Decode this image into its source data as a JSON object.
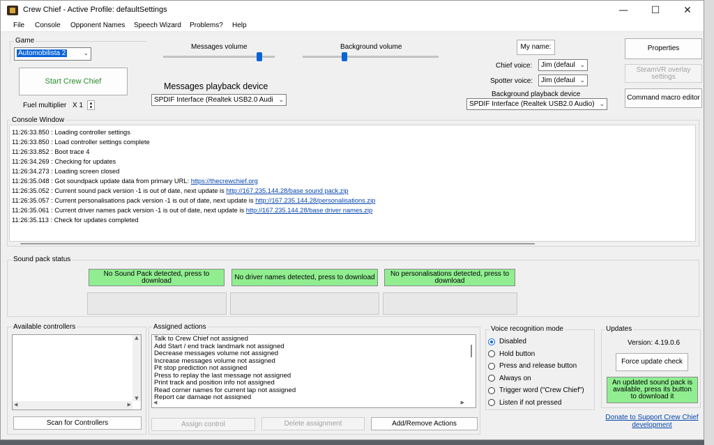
{
  "window": {
    "title": "Crew Chief - Active Profile: defaultSettings",
    "controls": {
      "minimize": "—",
      "maximize": "☐",
      "close": "✕"
    }
  },
  "menu": [
    "File",
    "Console",
    "Opponent Names",
    "Speech Wizard",
    "Problems?",
    "Help"
  ],
  "game": {
    "group_label": "Game",
    "selected": "Automobilista 2",
    "start_button": "Start Crew Chief",
    "fuel_multiplier_label": "Fuel multiplier",
    "fuel_multiplier_value": "X 1"
  },
  "volume": {
    "messages_label": "Messages volume",
    "messages_level": 0.88,
    "background_label": "Background volume",
    "background_level": 0.3
  },
  "playback": {
    "messages_device_label": "Messages playback device",
    "messages_device_value": "SPDIF Interface (Realtek USB2.0 Audi",
    "background_device_label": "Background playback device",
    "background_device_value": "SPDIF Interface (Realtek USB2.0 Audio)"
  },
  "voices": {
    "my_name_button": "My name:",
    "chief_label": "Chief voice:",
    "chief_value": "Jim (defaul",
    "spotter_label": "Spotter voice:",
    "spotter_value": "Jim (defaul"
  },
  "right_buttons": {
    "properties": "Properties",
    "steamvr": "SteamVR overlay settings",
    "command_macro": "Command macro editor"
  },
  "console": {
    "label": "Console Window",
    "lines": [
      {
        "text": "11:26:33.850 : Loading controller settings",
        "link": ""
      },
      {
        "text": "11:26:33.850 : Load controller settings complete",
        "link": ""
      },
      {
        "text": "11:26:33.852 : Boot trace 4",
        "link": ""
      },
      {
        "text": "11:26:34.269 : Checking for updates",
        "link": ""
      },
      {
        "text": "11:26:34.273 : Loading screen closed",
        "link": ""
      },
      {
        "text": "11:26:35.048 : Got soundpack update data from primary URL: ",
        "link": "https://thecrewchief.org"
      },
      {
        "text": "11:26:35.052 : Current sound pack version -1 is out of date, next update is ",
        "link": "http://167.235.144.28/base sound pack.zip"
      },
      {
        "text": "11:26:35.057 : Current personalisations pack version -1 is out of date, next update is ",
        "link": "http://167.235.144.28/personalisations.zip"
      },
      {
        "text": "11:26:35.061 : Current driver names pack version -1 is out of date, next update is ",
        "link": "http://167.235.144.28/base driver names.zip"
      },
      {
        "text": "11:26:35.113 : Check for updates completed",
        "link": ""
      }
    ],
    "scroll_position": 0.85
  },
  "sound_pack": {
    "label": "Sound pack status",
    "sound_pack_button": "No Sound Pack detected, press to download",
    "driver_names_button": "No driver names detected, press to download",
    "personalisations_button": "No personalisations detected, press to download"
  },
  "controllers": {
    "label": "Available controllers",
    "scan_button": "Scan for Controllers"
  },
  "actions": {
    "label": "Assigned actions",
    "items": [
      "Talk to Crew Chief not assigned",
      "Add Start / end track landmark not assigned",
      "Decrease messages volume not assigned",
      "Increase messages volume not assigned",
      "Pit stop prediction not assigned",
      "Press to replay the last message not assigned",
      "Print track and position info not assigned",
      "Read corner names for current lap not assigned",
      "Report car damage not assigned"
    ],
    "assign_button": "Assign control",
    "delete_button": "Delete assignment",
    "add_remove_button": "Add/Remove Actions"
  },
  "voice_recognition": {
    "label": "Voice recognition mode",
    "selected": 0,
    "options": [
      "Disabled",
      "Hold button",
      "Press and release button",
      "Always on",
      "Trigger word (\"Crew Chief\")",
      "Listen if not pressed"
    ]
  },
  "updates": {
    "label": "Updates",
    "version": "Version: 4.19.0.6",
    "force_button": "Force update check",
    "status_button": "An updated sound pack is available, press its button to download it",
    "donate_link": "Donate to Support Crew Chief development"
  },
  "colors": {
    "green": "#90ee90",
    "selection": "#0a64d8",
    "link": "#0645ad"
  }
}
